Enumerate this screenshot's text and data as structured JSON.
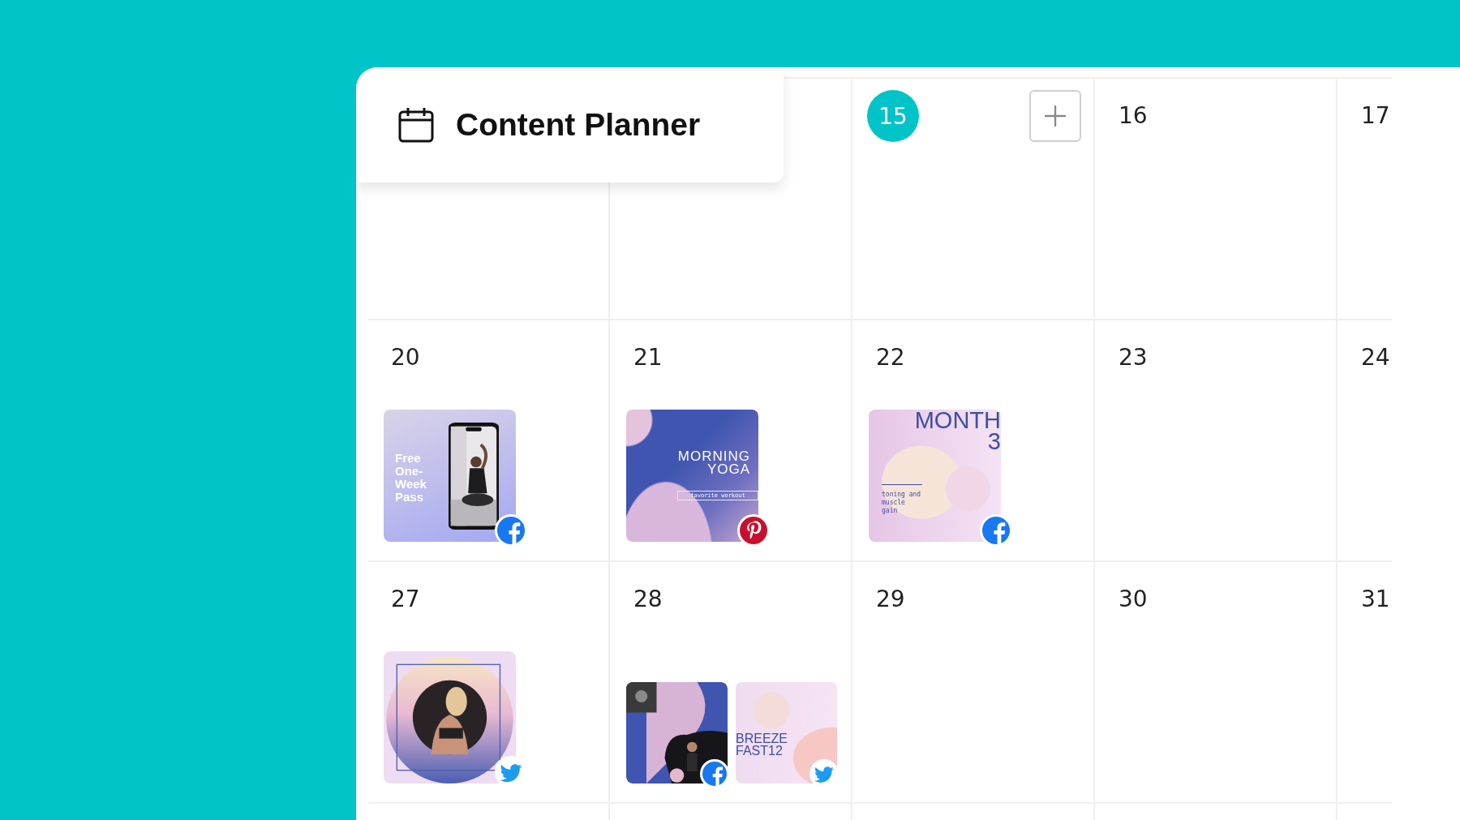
{
  "header": {
    "title": "Content Planner"
  },
  "weeks": [
    {
      "days": [
        {
          "label": "15",
          "today": true
        },
        {
          "label": "16",
          "today": false
        },
        {
          "label": "17",
          "today": false
        }
      ]
    },
    {
      "days": [
        {
          "label": "20",
          "today": false,
          "posts": [
            {
              "kind": "phone-promo",
              "badge": {
                "kind": "facebook"
              },
              "title": "Free One-Week Pass"
            }
          ]
        },
        {
          "label": "21",
          "today": false,
          "posts": [
            {
              "kind": "gradient-title",
              "badge": {
                "kind": "pinterest"
              },
              "title": "MORNING YOGA",
              "subtitle": "favorite workout"
            }
          ]
        },
        {
          "label": "22",
          "today": false,
          "posts": [
            {
              "kind": "month",
              "badge": {
                "kind": "facebook"
              },
              "title": "MONTH 3",
              "subtitle": "toning and muscle gain"
            }
          ]
        },
        {
          "label": "23",
          "today": false
        },
        {
          "label": "24",
          "today": false
        }
      ]
    },
    {
      "days": [
        {
          "label": "27",
          "today": false,
          "posts": [
            {
              "kind": "portrait-circle",
              "badge": {
                "kind": "twitter"
              }
            }
          ]
        },
        {
          "label": "28",
          "today": false,
          "posts": [
            {
              "kind": "photo-collage",
              "badge": {
                "kind": "facebook"
              }
            },
            {
              "kind": "breeze",
              "badge": {
                "kind": "twitter"
              },
              "title": "BREEZE FAST12"
            }
          ]
        },
        {
          "label": "29",
          "today": false
        },
        {
          "label": "30",
          "today": false
        },
        {
          "label": "31",
          "today": false
        }
      ]
    }
  ]
}
